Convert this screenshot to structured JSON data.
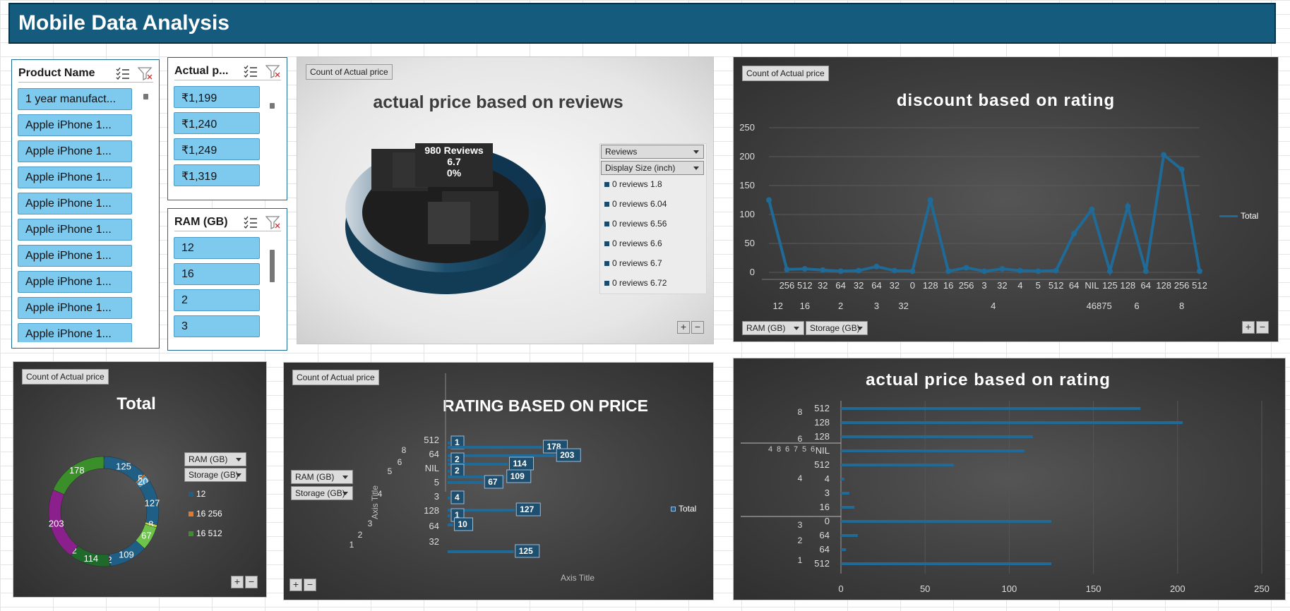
{
  "header": {
    "title": "Mobile Data Analysis"
  },
  "slicers": {
    "product": {
      "title": "Product Name",
      "items": [
        "1 year manufact...",
        "Apple iPhone 1...",
        "Apple iPhone 1...",
        "Apple iPhone 1...",
        "Apple iPhone 1...",
        "Apple iPhone 1...",
        "Apple iPhone 1...",
        "Apple iPhone 1...",
        "Apple iPhone 1...",
        "Apple iPhone 1..."
      ]
    },
    "actual_price": {
      "title": "Actual p...",
      "items": [
        "₹1,199",
        "₹1,240",
        "₹1,249",
        "₹1,319"
      ]
    },
    "ram": {
      "title": "RAM (GB)",
      "items": [
        "12",
        "16",
        "2",
        "3"
      ]
    }
  },
  "icons": {
    "multiselect": "multi-select-icon",
    "clear_filter": "clear-filter-icon"
  },
  "colors": {
    "header_bg": "#155b7e",
    "slicer_item": "#7ec9ee",
    "series_blue": "#1f5f85",
    "pie_green": "#3a8f2a",
    "pie_purple": "#8b1f8b",
    "pie_light_green": "#6ec44a",
    "pie_orange": "#e07a2a"
  },
  "chart_pie3d": {
    "field_button": "Count of Actual price",
    "title": "actual price based on reviews",
    "overlay": {
      "line1": "980 Reviews",
      "line2": "6.7",
      "line3": "0%"
    },
    "filters": [
      "Reviews",
      "Display Size (inch)"
    ],
    "legend": [
      "0 reviews 1.8",
      "0 reviews 6.04",
      "0 reviews 6.56",
      "0 reviews 6.6",
      "0 reviews 6.7",
      "0 reviews 6.72"
    ]
  },
  "chart_line": {
    "field_button": "Count of Actual price",
    "title": "discount based on rating",
    "legend": "Total",
    "filters": [
      "RAM (GB)",
      "Storage (GB)"
    ],
    "yticks": [
      "250",
      "200",
      "150",
      "100",
      "50",
      "0"
    ],
    "xinner": [
      "256",
      "512",
      "32",
      "64",
      "32",
      "64",
      "32",
      "0",
      "128",
      "16",
      "256",
      "3",
      "32",
      "4",
      "5",
      "512",
      "64",
      "NIL",
      "125",
      "128",
      "64",
      "128",
      "256",
      "512"
    ],
    "xgroups": [
      "12",
      "16",
      "2",
      "3",
      "32",
      "4",
      "46875",
      "6",
      "8"
    ]
  },
  "chart_donut": {
    "field_button": "Count of Actual price",
    "title": "Total",
    "filters": [
      "RAM (GB)",
      "Storage (GB)"
    ],
    "legend": [
      "12",
      "16 256",
      "16 512"
    ],
    "labels": [
      "1",
      "125",
      "5",
      "20",
      "127",
      "8",
      "67",
      "109",
      "2",
      "114",
      "2",
      "203",
      "178"
    ]
  },
  "chart_bars": {
    "field_button": "Count of Actual price",
    "title": "RATING BASED ON PRICE",
    "filters": [
      "RAM (GB)",
      "Storage (GB)"
    ],
    "legend": "Total",
    "yaxis_title": "Axis Title",
    "xaxis_title": "Axis Title",
    "cat_inner": [
      "512",
      "64",
      "NIL",
      "5",
      "3",
      "128",
      "64",
      "32"
    ],
    "cat_outer": [
      "8",
      "6",
      "5",
      "4",
      "3",
      "2",
      "1"
    ],
    "labels": [
      "1",
      "178",
      "203",
      "2",
      "114",
      "2",
      "109",
      "67",
      "4",
      "127",
      "1",
      "10",
      "125"
    ]
  },
  "chart_hbar": {
    "title": "actual price based on rating",
    "xticks": [
      "0",
      "50",
      "100",
      "150",
      "200",
      "250"
    ],
    "cat_inner": [
      "512",
      "128",
      "128",
      "NIL",
      "512",
      "4",
      "3",
      "16",
      "0",
      "64",
      "64",
      "512"
    ],
    "cat_outer": [
      "8",
      "6",
      "4",
      "3",
      "2",
      "1"
    ],
    "group_labels": [
      "4",
      "8",
      "6",
      "7",
      "5",
      "6"
    ]
  },
  "chart_data": [
    {
      "type": "line",
      "title": "discount based on rating",
      "series": [
        {
          "name": "Total",
          "values": [
            125,
            5,
            6,
            4,
            2,
            3,
            10,
            3,
            2,
            125,
            2,
            8,
            2,
            6,
            3,
            2,
            3,
            67,
            109,
            2,
            114,
            2,
            203,
            178,
            2
          ]
        }
      ],
      "ylim": [
        0,
        250
      ]
    },
    {
      "type": "pie",
      "title": "Total",
      "values": [
        1,
        125,
        5,
        20,
        127,
        8,
        67,
        109,
        2,
        114,
        2,
        203,
        178
      ]
    },
    {
      "type": "bar",
      "title": "RATING BASED ON PRICE",
      "values": [
        1,
        178,
        203,
        2,
        114,
        2,
        109,
        67,
        4,
        127,
        1,
        10,
        125
      ]
    },
    {
      "type": "bar",
      "title": "actual price based on rating",
      "values": [
        178,
        203,
        114,
        109,
        67,
        2,
        5,
        8,
        125,
        10,
        3,
        125
      ],
      "xlim": [
        0,
        250
      ]
    }
  ]
}
